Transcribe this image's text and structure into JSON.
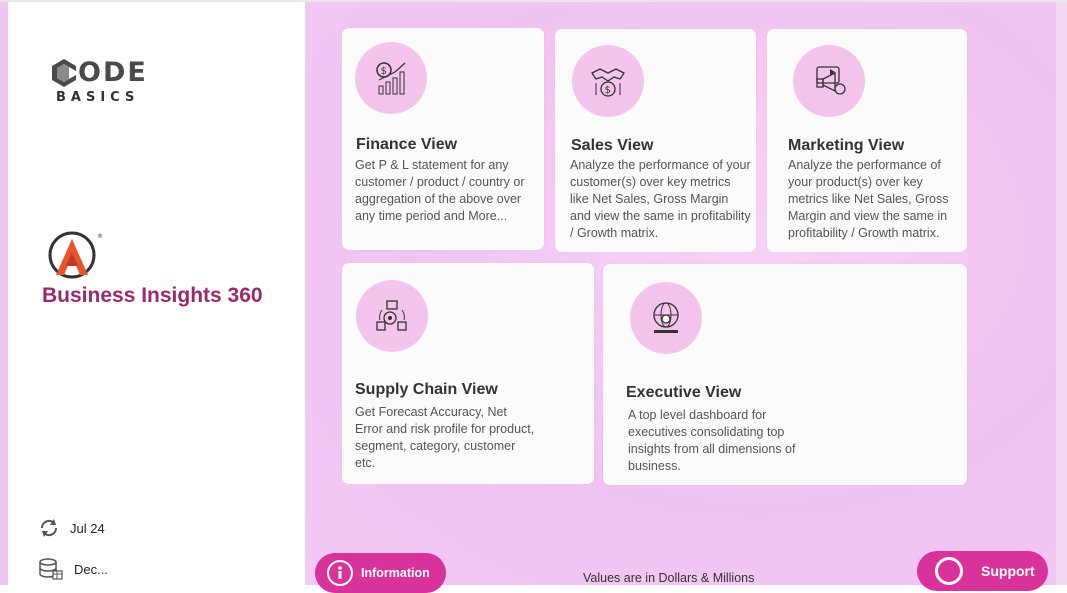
{
  "sidebar": {
    "logo": {
      "code": "ODE",
      "basics": "BASICS"
    },
    "brand_title": "Business Insights 360",
    "refresh_date": "Jul 24",
    "data_date": "Dec..."
  },
  "cards": [
    {
      "title": "Finance View",
      "desc": "Get P & L statement for any customer / product / country or aggregation of the above over any time period and More...",
      "icon": "finance-growth-icon"
    },
    {
      "title": "Sales View",
      "desc": "Analyze the performance of your customer(s) over key metrics like Net Sales, Gross Margin and view the same in profitability / Growth matrix.",
      "icon": "handshake-money-icon"
    },
    {
      "title": "Marketing View",
      "desc": "Analyze the performance of your product(s) over key metrics like Net Sales, Gross Margin and view the same in profitability / Growth matrix.",
      "icon": "megaphone-marketing-icon"
    },
    {
      "title": "Supply Chain View",
      "desc": "Get Forecast Accuracy, Net Error and risk profile for product, segment, category, customer etc.",
      "icon": "supply-chain-icon"
    },
    {
      "title": "Executive View",
      "desc": "A top level dashboard for executives consolidating top insights from all dimensions of business.",
      "icon": "globe-executive-icon"
    }
  ],
  "buttons": {
    "information": "Information",
    "support": "Support"
  },
  "footnote": "Values are in Dollars & Millions",
  "colors": {
    "accent": "#d9329a",
    "brand": "#9b2a6a",
    "background": "#f3c9f3"
  }
}
